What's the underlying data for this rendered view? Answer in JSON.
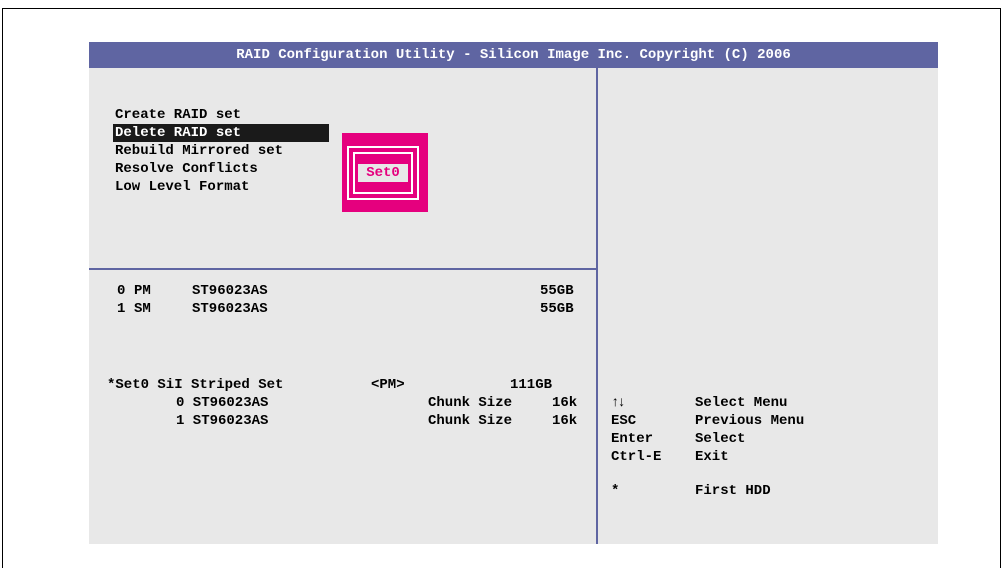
{
  "title": "RAID Configuration Utility - Silicon Image Inc. Copyright (C) 2006",
  "menu": [
    {
      "label": "Create RAID set",
      "selected": false
    },
    {
      "label": "Delete RAID set",
      "selected": true
    },
    {
      "label": "Rebuild Mirrored set",
      "selected": false
    },
    {
      "label": "Resolve Conflicts",
      "selected": false
    },
    {
      "label": "Low Level Format",
      "selected": false
    }
  ],
  "popup": {
    "item": "Set0"
  },
  "drives": [
    {
      "index": "0",
      "role": "PM",
      "model": "ST96023AS",
      "size": "55GB"
    },
    {
      "index": "1",
      "role": "SM",
      "model": "ST96023AS",
      "size": "55GB"
    }
  ],
  "raid_set": {
    "name": "*Set0 SiI Striped Set",
    "role": "<PM>",
    "size": "111GB",
    "members": [
      {
        "label": "0 ST96023AS",
        "chunk_label": "Chunk Size",
        "chunk": "16k"
      },
      {
        "label": "1 ST96023AS",
        "chunk_label": "Chunk Size",
        "chunk": "16k"
      }
    ]
  },
  "help": [
    {
      "key": "↑↓",
      "desc": "Select Menu"
    },
    {
      "key": "ESC",
      "desc": "Previous Menu"
    },
    {
      "key": "Enter",
      "desc": "Select"
    },
    {
      "key": "Ctrl-E",
      "desc": "Exit"
    },
    {
      "key": "*",
      "desc": "First HDD"
    }
  ],
  "colors": {
    "title_bar": "#5f65a2",
    "panel_background": "#e8e8e8",
    "popup_accent": "#e5007e",
    "selection": "#1a1a1a"
  }
}
